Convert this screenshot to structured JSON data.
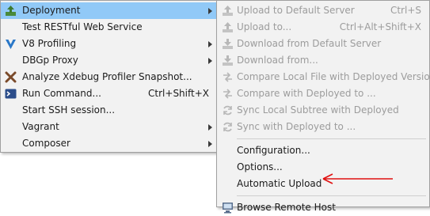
{
  "left_menu": {
    "items": [
      {
        "label": "Deployment",
        "icon": "deployment-icon",
        "has_submenu": true,
        "selected": true
      },
      {
        "label": "Test RESTful Web Service"
      },
      {
        "label": "V8 Profiling",
        "icon": "v8-icon",
        "has_submenu": true
      },
      {
        "label": "DBGp Proxy",
        "has_submenu": true
      },
      {
        "label": "Analyze Xdebug Profiler Snapshot...",
        "icon": "xdebug-icon"
      },
      {
        "label": "Run Command...",
        "icon": "terminal-icon",
        "shortcut": "Ctrl+Shift+X"
      },
      {
        "label": "Start SSH session..."
      },
      {
        "label": "Vagrant",
        "has_submenu": true
      },
      {
        "label": "Composer",
        "has_submenu": true
      }
    ]
  },
  "right_menu": {
    "items": [
      {
        "label": "Upload to Default Server",
        "icon": "upload-icon",
        "shortcut": "Ctrl+S",
        "disabled": true
      },
      {
        "label": "Upload to...",
        "icon": "upload-icon",
        "shortcut": "Ctrl+Alt+Shift+X",
        "disabled": true
      },
      {
        "label": "Download from Default Server",
        "icon": "download-icon",
        "disabled": true
      },
      {
        "label": "Download from...",
        "icon": "download-icon",
        "disabled": true
      },
      {
        "label": "Compare Local File with Deployed Version",
        "icon": "compare-icon",
        "disabled": true
      },
      {
        "label": "Compare with Deployed to ...",
        "icon": "compare-icon",
        "disabled": true
      },
      {
        "label": "Sync Local Subtree with Deployed",
        "icon": "sync-icon",
        "disabled": true
      },
      {
        "label": "Sync with Deployed to ...",
        "icon": "sync-icon",
        "disabled": true
      },
      {
        "label": "Configuration..."
      },
      {
        "label": "Options..."
      },
      {
        "label": "Automatic Upload"
      },
      {
        "label": "Browse Remote Host",
        "icon": "remote-host-icon"
      }
    ]
  },
  "colors": {
    "selection": "#91c9f7",
    "annotation_arrow": "#e01010",
    "disabled_text": "#9c9c9c"
  }
}
